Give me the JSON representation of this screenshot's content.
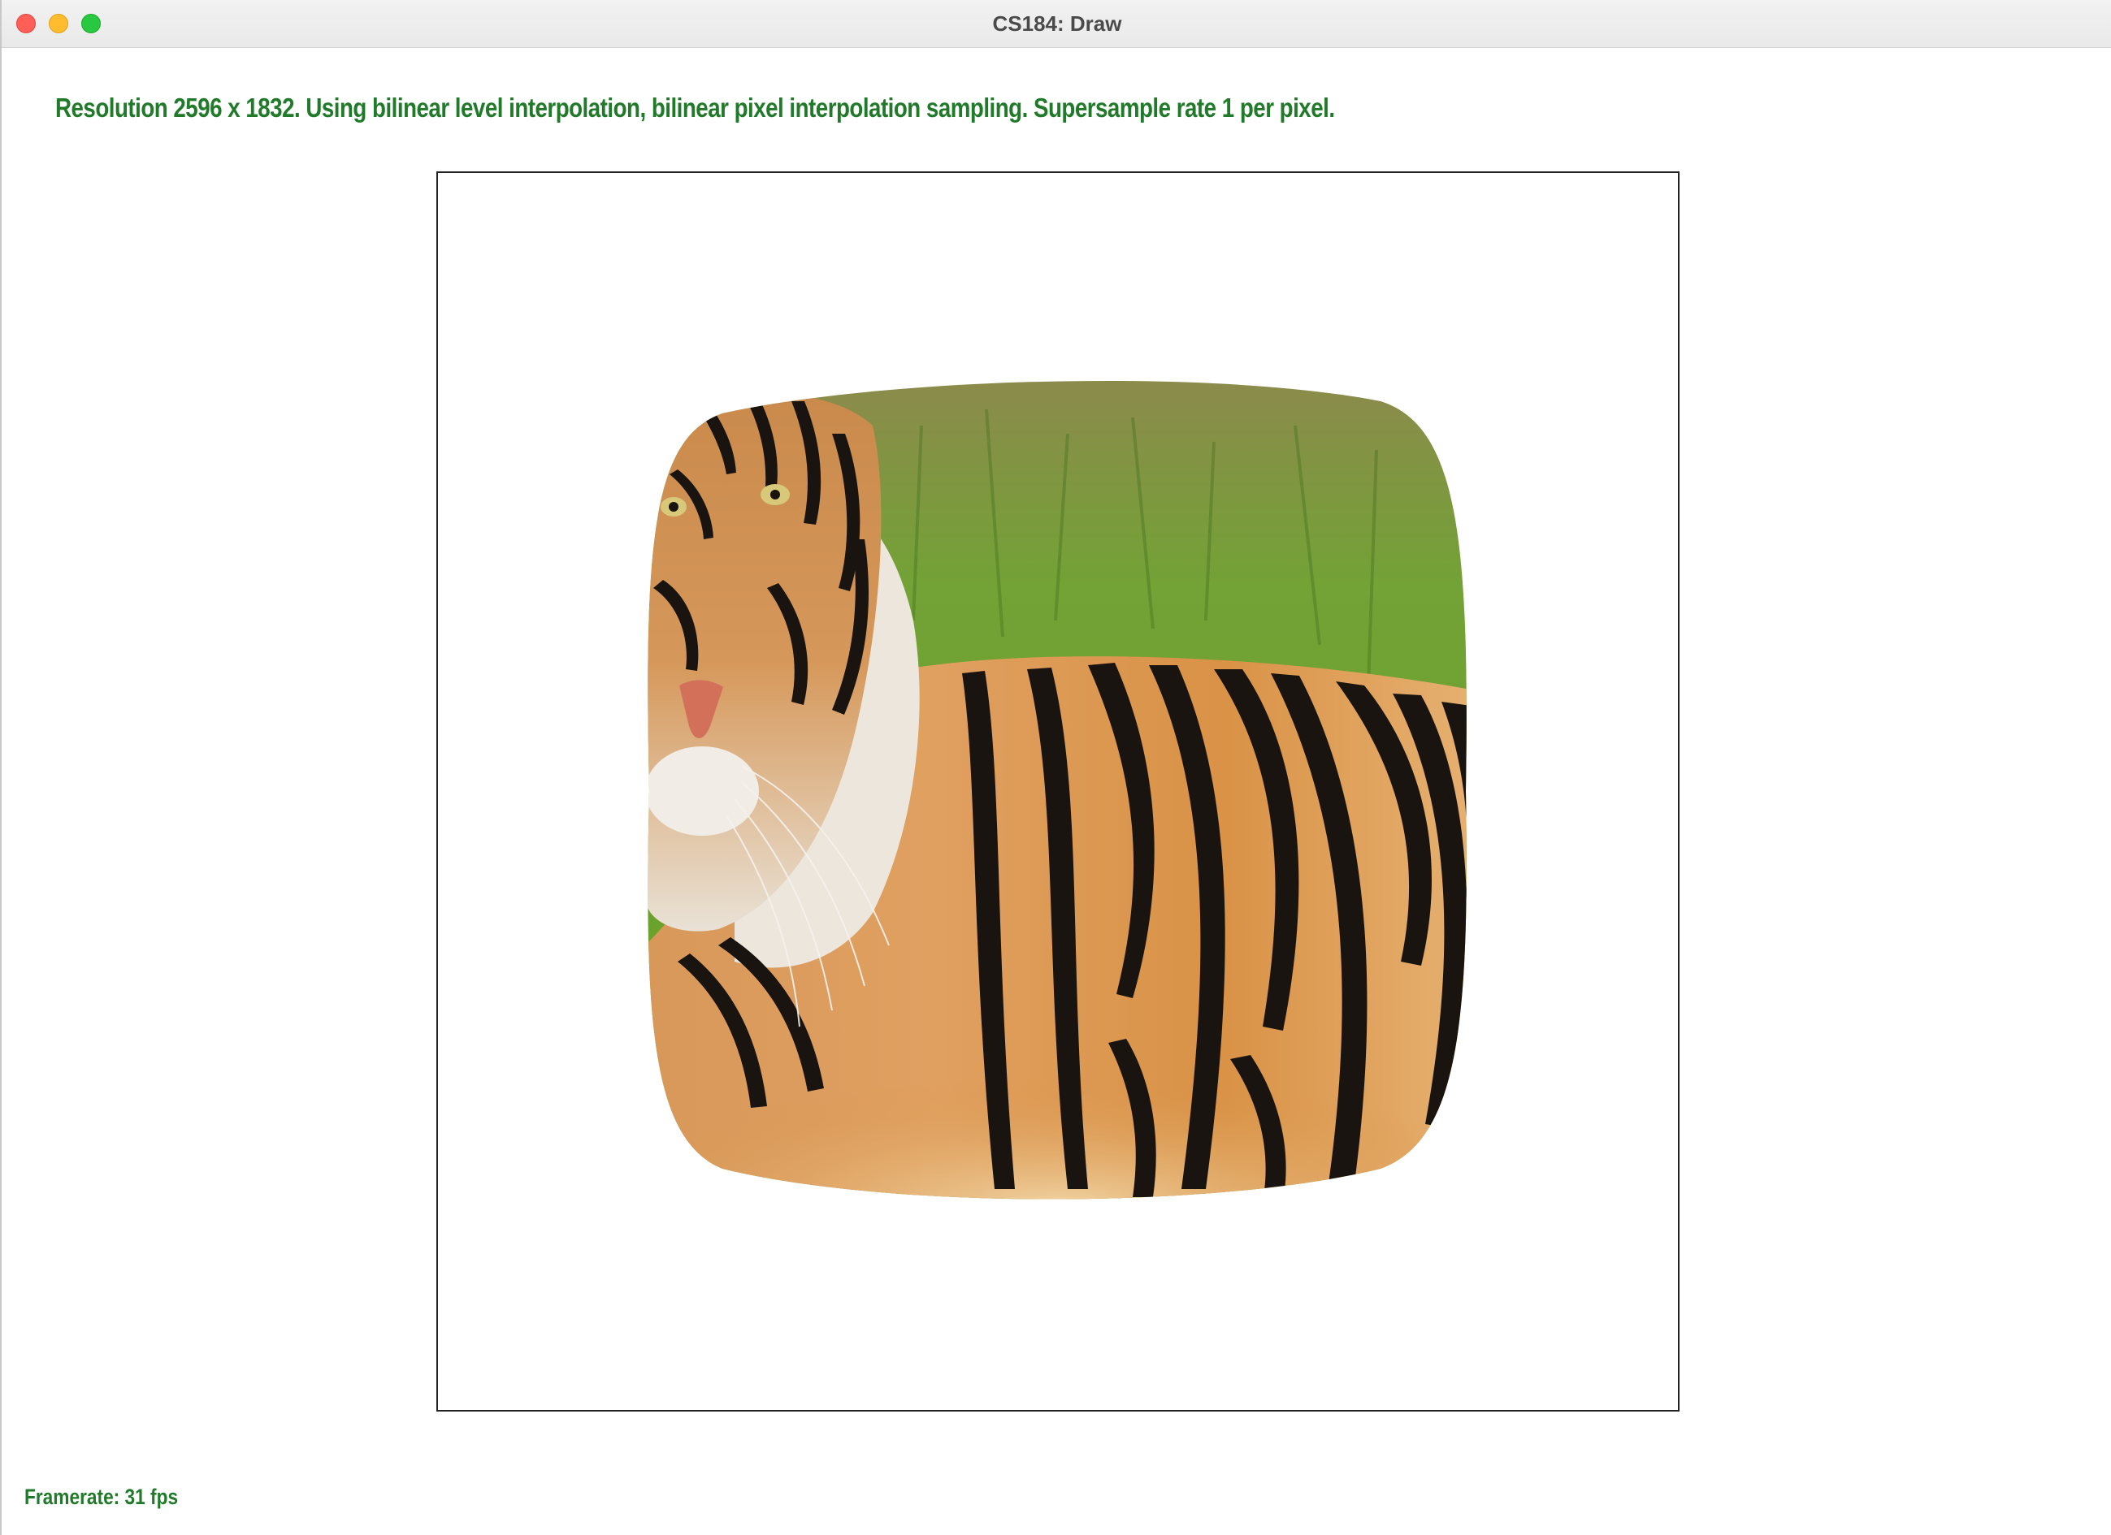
{
  "window": {
    "title": "CS184: Draw"
  },
  "status": {
    "info_line": "Resolution 2596 x 1832. Using bilinear level interpolation, bilinear pixel interpolation sampling. Supersample rate 1 per pixel.",
    "framerate": "Framerate: 31 fps"
  },
  "canvas": {
    "image": "tiger-texture-warped"
  },
  "colors": {
    "status_text": "#217a2a",
    "close": "#ff5f57",
    "minimize": "#febc2e",
    "maximize": "#28c840"
  }
}
